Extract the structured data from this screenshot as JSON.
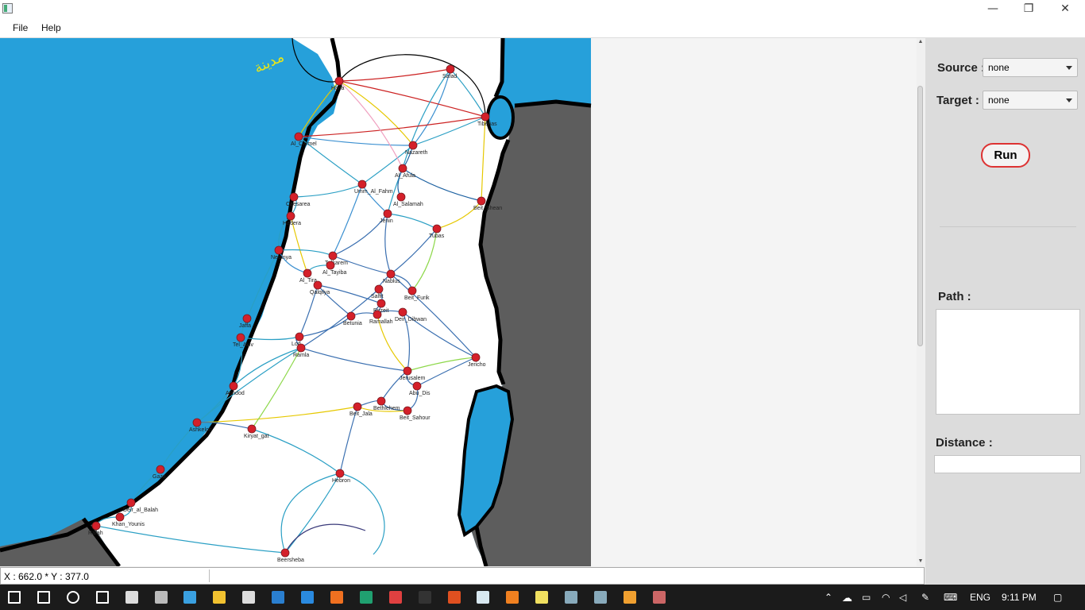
{
  "window": {
    "minimize_glyph": "—",
    "restore_glyph": "❐",
    "close_glyph": "✕"
  },
  "menu": {
    "file": "File",
    "help": "Help"
  },
  "map": {
    "annotation": "مدينة",
    "cities": [
      {
        "name": "Safad"
      },
      {
        "name": "Haifa"
      },
      {
        "name": "Tiberias"
      },
      {
        "name": "Al_Carmel"
      },
      {
        "name": "Nazareth"
      },
      {
        "name": "Al_Afula"
      },
      {
        "name": "Umm_Al_Fahm"
      },
      {
        "name": "Al_Salamah"
      },
      {
        "name": "Caesarea"
      },
      {
        "name": "Beit_Shean"
      },
      {
        "name": "Jenin"
      },
      {
        "name": "Hadera"
      },
      {
        "name": "Tubas"
      },
      {
        "name": "Netanya"
      },
      {
        "name": "Tulkarem"
      },
      {
        "name": "Al_Tayiba"
      },
      {
        "name": "Al_Tira"
      },
      {
        "name": "Nablus"
      },
      {
        "name": "Qalqilya"
      },
      {
        "name": "Salfit"
      },
      {
        "name": "Beit_Furik"
      },
      {
        "name": "Birzeit"
      },
      {
        "name": "Betunia"
      },
      {
        "name": "Ramallah"
      },
      {
        "name": "Deir_Dibwan"
      },
      {
        "name": "Jaffa"
      },
      {
        "name": "Tel_Aviv"
      },
      {
        "name": "Lod"
      },
      {
        "name": "Ramla"
      },
      {
        "name": "Jericho"
      },
      {
        "name": "Jerusalem"
      },
      {
        "name": "Abu_Dis"
      },
      {
        "name": "Ashdod"
      },
      {
        "name": "Beit_Jala"
      },
      {
        "name": "Bethlehem"
      },
      {
        "name": "Beit_Sahour"
      },
      {
        "name": "Ashkelon"
      },
      {
        "name": "Kiryat_gat"
      },
      {
        "name": "Gaza"
      },
      {
        "name": "Hebron"
      },
      {
        "name": "Deir_al_Balah"
      },
      {
        "name": "Khan_Younis"
      },
      {
        "name": "Rafah"
      },
      {
        "name": "Beersheba"
      }
    ],
    "colors": {
      "sea": "#26a0da",
      "land": "#ffffff",
      "outside": "#5d5d5d",
      "coast": "#000000",
      "city": "#d4202a"
    }
  },
  "status": {
    "coords": "X : 662.0 * Y : 377.0"
  },
  "side": {
    "source_label": "Source :",
    "source_value": "none",
    "target_label": "Target :",
    "target_value": "none",
    "run_label": "Run",
    "path_label": "Path :",
    "distance_label": "Distance :"
  },
  "taskbar": {
    "lang": "ENG",
    "time": "9:11 PM",
    "icons": [
      "start-icon",
      "search-icon",
      "cortana-icon",
      "task-view-icon",
      "mail-icon",
      "calculator-icon",
      "desktop-icon",
      "file-explorer-icon",
      "store-icon",
      "photos-icon",
      "edge-icon",
      "firefox-icon",
      "edge-dev-icon",
      "chrome-icon",
      "cmd-icon",
      "ubuntu-icon",
      "notepad-icon",
      "sublime-icon",
      "notes-icon",
      "network-icon",
      "app-icon-2",
      "app-icon-3",
      "java-icon"
    ]
  }
}
